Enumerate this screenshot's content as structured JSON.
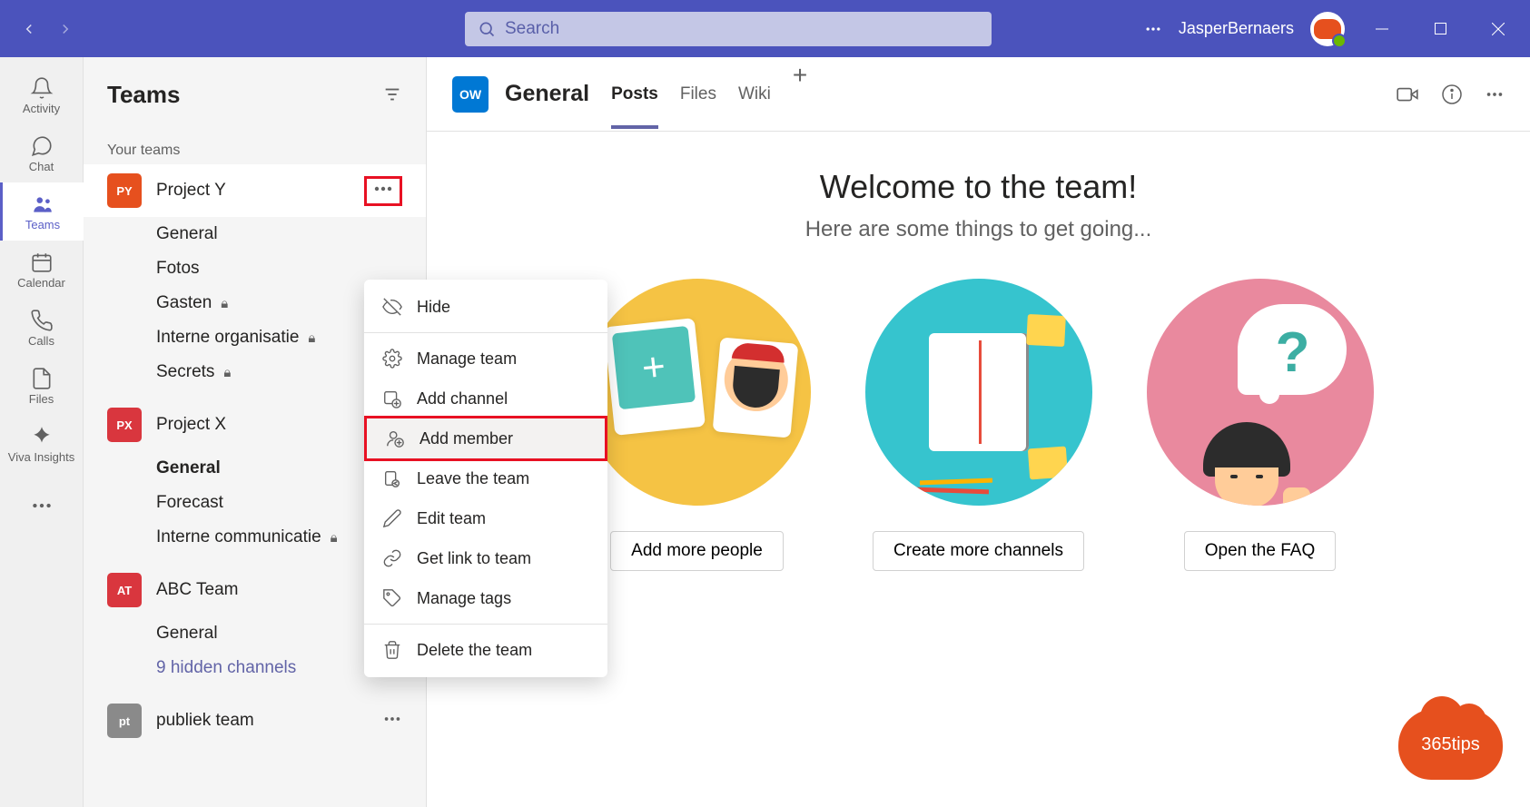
{
  "titlebar": {
    "search_placeholder": "Search",
    "username": "JasperBernaers"
  },
  "rail": {
    "items": [
      {
        "label": "Activity"
      },
      {
        "label": "Chat"
      },
      {
        "label": "Teams"
      },
      {
        "label": "Calendar"
      },
      {
        "label": "Calls"
      },
      {
        "label": "Files"
      },
      {
        "label": "Viva Insights"
      }
    ]
  },
  "panel": {
    "title": "Teams",
    "section": "Your teams",
    "teams": [
      {
        "initials": "PY",
        "name": "Project Y",
        "color": "#e6501e",
        "channels": [
          {
            "name": "General",
            "locked": false
          },
          {
            "name": "Fotos",
            "locked": false
          },
          {
            "name": "Gasten",
            "locked": true
          },
          {
            "name": "Interne organisatie",
            "locked": true
          },
          {
            "name": "Secrets",
            "locked": true
          }
        ]
      },
      {
        "initials": "PX",
        "name": "Project X",
        "color": "#d9363e",
        "channels": [
          {
            "name": "General",
            "bold": true
          },
          {
            "name": "Forecast"
          },
          {
            "name": "Interne communicatie",
            "locked": true
          }
        ]
      },
      {
        "initials": "AT",
        "name": "ABC Team",
        "color": "#d9363e",
        "channels": [
          {
            "name": "General"
          }
        ],
        "hidden_link": "9 hidden channels"
      },
      {
        "initials": "pt",
        "name": "publiek team",
        "color": "#8a8a8a",
        "channels": []
      }
    ]
  },
  "context_menu": {
    "hide": "Hide",
    "manage": "Manage team",
    "add_channel": "Add channel",
    "add_member": "Add member",
    "leave": "Leave the team",
    "edit": "Edit team",
    "get_link": "Get link to team",
    "manage_tags": "Manage tags",
    "delete": "Delete the team"
  },
  "content": {
    "team_badge": "OW",
    "channel_title": "General",
    "tabs": [
      "Posts",
      "Files",
      "Wiki"
    ],
    "welcome_title": "Welcome to the team!",
    "welcome_sub": "Here are some things to get going...",
    "cards": {
      "add_people": "Add more people",
      "create_channels": "Create more channels",
      "open_faq": "Open the FAQ"
    }
  },
  "branding": {
    "logo_text": "365tips"
  }
}
